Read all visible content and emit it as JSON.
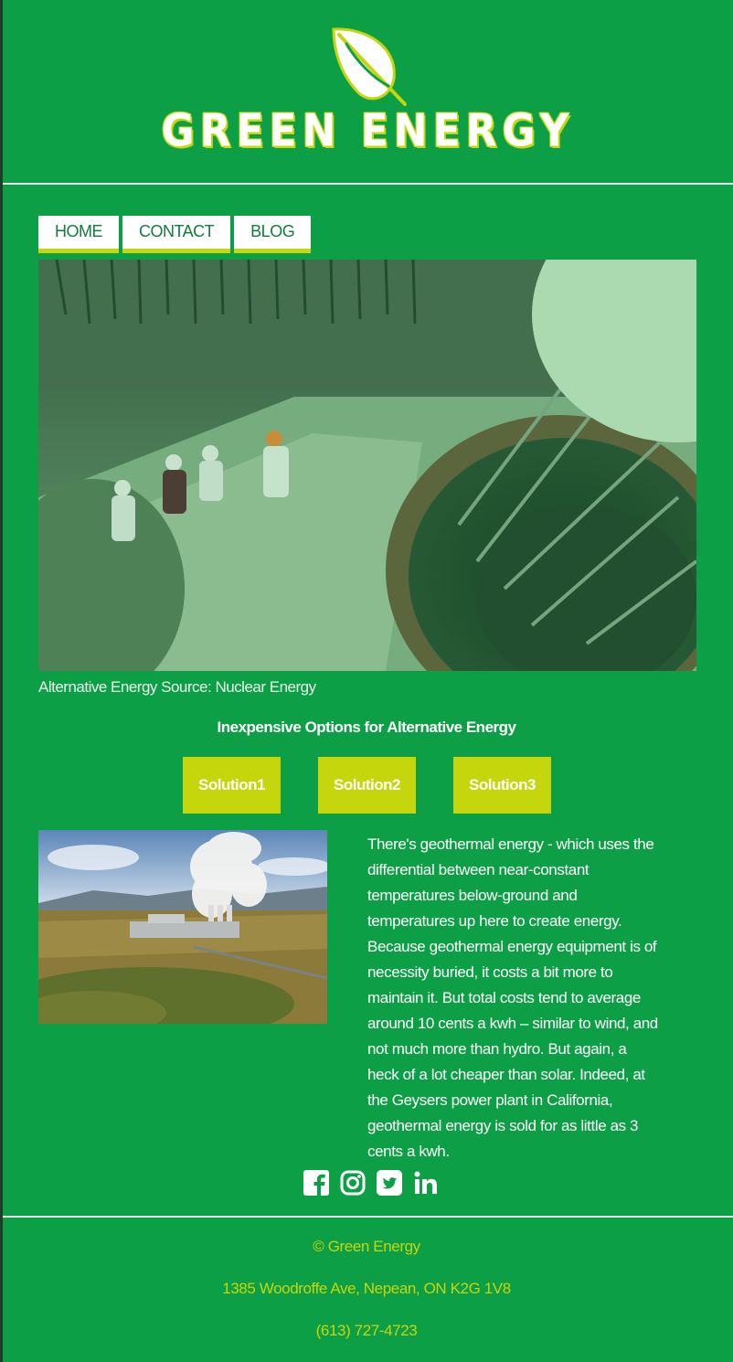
{
  "brand": {
    "name": "GREEN ENERGY",
    "accent": "#c5d60c",
    "background": "#0c9f45"
  },
  "nav": {
    "items": [
      "HOME",
      "CONTACT",
      "BLOG"
    ]
  },
  "hero": {
    "caption": "Alternative Energy Source: Nuclear Energy",
    "icon": "nuclear-reactor-photo"
  },
  "section": {
    "title": "Inexpensive Options for Alternative Energy"
  },
  "solutions": [
    "Solution1",
    "Solution2",
    "Solution3"
  ],
  "article": {
    "image": "geothermal-plant-photo",
    "text": "There's geothermal energy - which uses the differential between near-constant temperatures below-ground and temperatures up here to create energy. Because geothermal energy equipment is of necessity buried, it costs a bit more to maintain it. But total costs tend to average around 10 cents a kwh – similar to wind, and not much more than hydro. But again, a heck of a lot cheaper than solar. Indeed, at the Geysers power plant in California, geothermal energy is sold for as little as 3 cents a kwh."
  },
  "social": [
    "facebook-icon",
    "instagram-icon",
    "twitter-icon",
    "linkedin-icon"
  ],
  "footer": {
    "copyright": "© Green Energy",
    "address": "1385 Woodroffe Ave, Nepean, ON K2G 1V8",
    "phone": "(613) 727-4723"
  }
}
